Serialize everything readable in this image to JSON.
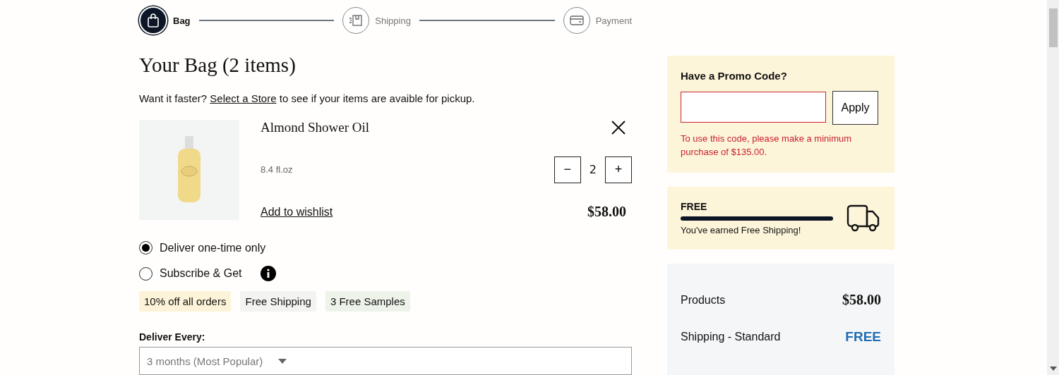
{
  "steps": [
    {
      "label": "Bag",
      "kind": "bag",
      "selected": true
    },
    {
      "label": "Shipping",
      "kind": "shipping",
      "selected": false
    },
    {
      "label": "Payment",
      "kind": "payment",
      "selected": false
    }
  ],
  "bag": {
    "title": "Your Bag (2 items)",
    "pickup_before": "Want it faster?",
    "pickup_link": "Select a Store",
    "pickup_after": "to see if your items are avaible for pickup.",
    "item": {
      "name": "Almond Shower Oil",
      "size": "8.4 fl.oz",
      "quantity": "2",
      "minus": "−",
      "plus": "+",
      "wishlist": "Add to wishlist",
      "price": "$58.00"
    },
    "delivery_options": [
      {
        "label": "Deliver one-time only",
        "selected": true,
        "info": false
      },
      {
        "label": "Subscribe & Get",
        "selected": false,
        "info": true
      }
    ],
    "perks": [
      {
        "label": "10% off all orders",
        "color": "#fdf3d8"
      },
      {
        "label": "Free Shipping",
        "color": "#f3f4f1"
      },
      {
        "label": "3 Free Samples",
        "color": "#eef3ea"
      }
    ],
    "frequency": {
      "label": "Deliver Every:",
      "value": "3 months (Most Popular)"
    }
  },
  "promo": {
    "title": "Have a Promo Code?",
    "button": "Apply",
    "error": "To use this code, please make a minimum purchase of $135.00."
  },
  "shipping_progress": {
    "label": "FREE",
    "level": 1,
    "message": "You've earned Free Shipping!"
  },
  "summary": {
    "rows": [
      {
        "label": "Products",
        "value": "$58.00",
        "kind": "price"
      },
      {
        "label": "Shipping - Standard",
        "value": "FREE",
        "kind": "free"
      }
    ]
  }
}
